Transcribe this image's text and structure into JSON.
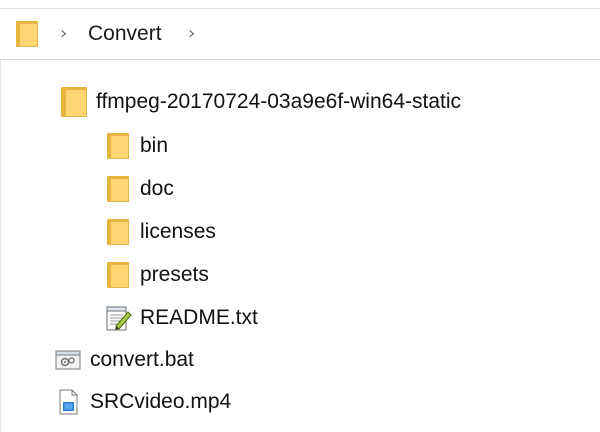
{
  "address": {
    "separator": "›",
    "crumb": "Convert"
  },
  "items": [
    {
      "label": "ffmpeg-20170724-03a9e6f-win64-static",
      "icon": "folder-icon"
    },
    {
      "label": "bin",
      "icon": "folder-icon"
    },
    {
      "label": "doc",
      "icon": "folder-icon"
    },
    {
      "label": "licenses",
      "icon": "folder-icon"
    },
    {
      "label": "presets",
      "icon": "folder-icon"
    },
    {
      "label": "README.txt",
      "icon": "text-file-edit-icon"
    },
    {
      "label": "convert.bat",
      "icon": "batch-file-icon"
    },
    {
      "label": "SRCvideo.mp4",
      "icon": "video-file-icon"
    }
  ]
}
